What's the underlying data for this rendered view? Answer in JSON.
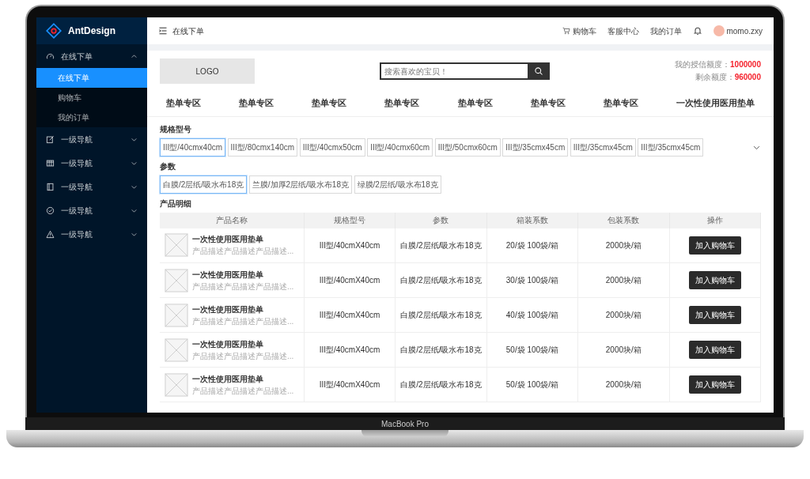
{
  "laptop": {
    "label": "MacBook Pro"
  },
  "sidebar": {
    "logo_text": "AntDesign",
    "items": [
      {
        "label": "在线下单",
        "kind": "dashboard",
        "expanded": true,
        "children": [
          {
            "label": "在线下单",
            "selected": true
          },
          {
            "label": "购物车",
            "selected": false
          },
          {
            "label": "我的订单",
            "selected": false
          }
        ]
      },
      {
        "label": "一级导航",
        "kind": "edit",
        "expanded": false
      },
      {
        "label": "一级导航",
        "kind": "table",
        "expanded": false
      },
      {
        "label": "一级导航",
        "kind": "book",
        "expanded": false
      },
      {
        "label": "一级导航",
        "kind": "check",
        "expanded": false
      },
      {
        "label": "一级导航",
        "kind": "warning",
        "expanded": false
      }
    ]
  },
  "header": {
    "title": "在线下单",
    "links": [
      {
        "label": "购物车",
        "kind": "cart"
      },
      {
        "label": "客服中心",
        "kind": "text"
      },
      {
        "label": "我的订单",
        "kind": "text"
      }
    ],
    "user": "momo.zxy"
  },
  "store": {
    "logo": "LOGO",
    "search": {
      "placeholder": "搜索喜欢的宝贝！"
    },
    "credit": [
      {
        "label": "我的授信额度：",
        "value": "1000000"
      },
      {
        "label": "剩余额度：",
        "value": "960000"
      }
    ]
  },
  "categories": [
    "垫单专区",
    "垫单专区",
    "垫单专区",
    "垫单专区",
    "垫单专区",
    "垫单专区",
    "垫单专区",
    "一次性使用医用垫单"
  ],
  "spec": {
    "label": "规格型号",
    "options": [
      {
        "label": "III型/40cmx40cm",
        "selected": true
      },
      {
        "label": "III型/80cmx140cm",
        "selected": false
      },
      {
        "label": "III型/40cmx50cm",
        "selected": false
      },
      {
        "label": "III型/40cmx60cm",
        "selected": false
      },
      {
        "label": "III型/50cmx60cm",
        "selected": false
      },
      {
        "label": "III型/35cmx45cm",
        "selected": false
      },
      {
        "label": "III型/35cmx45cm",
        "selected": false
      },
      {
        "label": "III型/35cmx45cm",
        "selected": false
      }
    ]
  },
  "params": {
    "label": "参数",
    "options": [
      {
        "label": "白膜/2层纸/吸水布18克",
        "selected": true
      },
      {
        "label": "兰膜/加厚2层纸/吸水布18克",
        "selected": false
      },
      {
        "label": "绿膜/2层纸/吸水布18克",
        "selected": false
      }
    ]
  },
  "products": {
    "title": "产品明细",
    "columns": [
      "产品名称",
      "规格型号",
      "参数",
      "箱装系数",
      "包装系数",
      "操作"
    ],
    "rows": [
      {
        "name": "一次性使用医用垫单",
        "desc": "产品描述产品描述产品描述...",
        "spec": "III型/40cmX40cm",
        "param": "白膜/2层纸/吸水布18克",
        "inner": "20/袋 100袋/箱",
        "pack": "2000块/箱",
        "action": "加入购物车"
      },
      {
        "name": "一次性使用医用垫单",
        "desc": "产品描述产品描述产品描述...",
        "spec": "III型/40cmX40cm",
        "param": "白膜/2层纸/吸水布18克",
        "inner": "30/袋 100袋/箱",
        "pack": "2000块/箱",
        "action": "加入购物车"
      },
      {
        "name": "一次性使用医用垫单",
        "desc": "产品描述产品描述产品描述...",
        "spec": "III型/40cmX40cm",
        "param": "白膜/2层纸/吸水布18克",
        "inner": "40/袋 100袋/箱",
        "pack": "2000块/箱",
        "action": "加入购物车"
      },
      {
        "name": "一次性使用医用垫单",
        "desc": "产品描述产品描述产品描述...",
        "spec": "III型/40cmX40cm",
        "param": "白膜/2层纸/吸水布18克",
        "inner": "50/袋 100袋/箱",
        "pack": "2000块/箱",
        "action": "加入购物车"
      },
      {
        "name": "一次性使用医用垫单",
        "desc": "产品描述产品描述产品描述...",
        "spec": "III型/40cmX40cm",
        "param": "白膜/2层纸/吸水布18克",
        "inner": "50/袋 100袋/箱",
        "pack": "2000块/箱",
        "action": "加入购物车"
      }
    ]
  }
}
